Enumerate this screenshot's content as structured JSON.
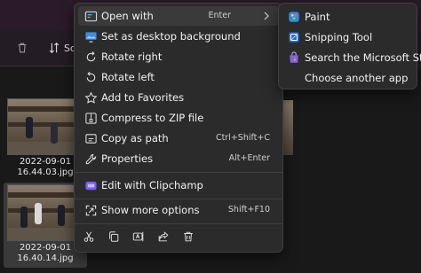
{
  "toolbar": {
    "sort_label": "So"
  },
  "files": [
    {
      "name_line1": "2022-09-01",
      "name_line2": "16.44.03.jpg"
    },
    {
      "name_line1": "2022-09-01",
      "name_line2": "16.40.14.jpg"
    }
  ],
  "context_menu": {
    "items": [
      {
        "label": "Open with",
        "shortcut": "Enter",
        "icon": "open-with-icon",
        "has_submenu": true
      },
      {
        "label": "Set as desktop background",
        "shortcut": "",
        "icon": "desktop-background-icon"
      },
      {
        "label": "Rotate right",
        "shortcut": "",
        "icon": "rotate-right-icon"
      },
      {
        "label": "Rotate left",
        "shortcut": "",
        "icon": "rotate-left-icon"
      },
      {
        "label": "Add to Favorites",
        "shortcut": "",
        "icon": "star-icon"
      },
      {
        "label": "Compress to ZIP file",
        "shortcut": "",
        "icon": "zip-icon"
      },
      {
        "label": "Copy as path",
        "shortcut": "Ctrl+Shift+C",
        "icon": "copy-path-icon"
      },
      {
        "label": "Properties",
        "shortcut": "Alt+Enter",
        "icon": "properties-icon"
      },
      {
        "label": "Edit with Clipchamp",
        "shortcut": "",
        "icon": "clipchamp-icon"
      },
      {
        "label": "Show more options",
        "shortcut": "Shift+F10",
        "icon": "more-options-icon"
      }
    ],
    "bottom_actions": [
      "cut-icon",
      "copy-icon",
      "rename-icon",
      "share-icon",
      "delete-icon"
    ]
  },
  "open_with_submenu": {
    "items": [
      {
        "label": "Paint",
        "icon": "paint-icon"
      },
      {
        "label": "Snipping Tool",
        "icon": "snipping-tool-icon"
      },
      {
        "label": "Search the Microsoft Store",
        "icon": "store-icon"
      },
      {
        "label": "Choose another app",
        "icon": ""
      }
    ]
  },
  "colors": {
    "menu_bg": "#2b2b2b",
    "hover_bg": "#3a3a3a",
    "accent": "#4cc2ff",
    "clipchamp": "#7b5cff"
  }
}
